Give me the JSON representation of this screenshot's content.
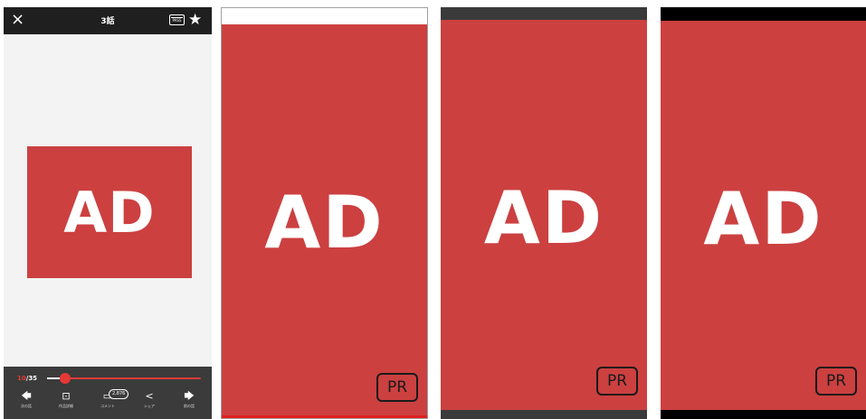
{
  "reader": {
    "episode_title": "3話",
    "close_icon": "×",
    "pass_label": "PASS",
    "star_icon": "★",
    "ad_label": "AD",
    "page": {
      "current": "10",
      "separator": "/",
      "total": "35",
      "progress_fraction": 0.12
    },
    "actions": [
      {
        "icon": "arrow-left-icon",
        "glyph": "🡄",
        "label": "次の話"
      },
      {
        "icon": "book-details-icon",
        "glyph": "⊡",
        "label": "作品詳細"
      },
      {
        "icon": "comment-icon",
        "glyph": "▭",
        "label": "コメント",
        "badge": "2,876"
      },
      {
        "icon": "share-icon",
        "glyph": "<",
        "label": "シェア"
      },
      {
        "icon": "arrow-right-icon",
        "glyph": "🡆",
        "label": "前の話"
      }
    ],
    "colors": {
      "accent": "#e53935",
      "ad_red": "#cc4040",
      "bar_dark": "#3b3b3b"
    }
  },
  "ad_screens": [
    {
      "ad_label": "AD",
      "pr_label": "PR"
    },
    {
      "ad_label": "AD",
      "pr_label": "PR"
    },
    {
      "ad_label": "AD",
      "pr_label": "PR"
    }
  ]
}
